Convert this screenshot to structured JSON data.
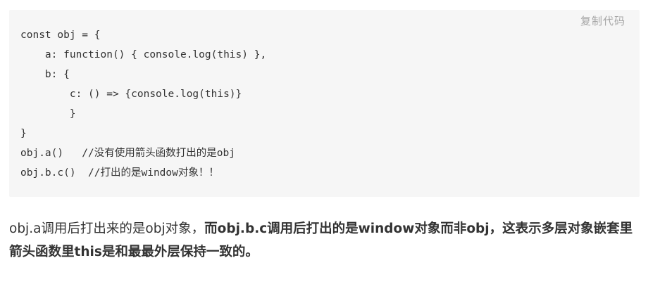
{
  "code_block": {
    "copy_label": "复制代码",
    "lines": [
      "const obj = {",
      "    a: function() { console.log(this) },",
      "    b: {",
      "        c: () => {console.log(this)}",
      "        }",
      "}",
      "obj.a()   //没有使用箭头函数打出的是obj",
      "obj.b.c()  //打出的是window对象！！"
    ]
  },
  "paragraph": {
    "normal": "obj.a调用后打出来的是obj对象，",
    "bold": "而obj.b.c调用后打出的是window对象而非obj，这表示多层对象嵌套里箭头函数里this是和最最外层保持一致的。"
  }
}
